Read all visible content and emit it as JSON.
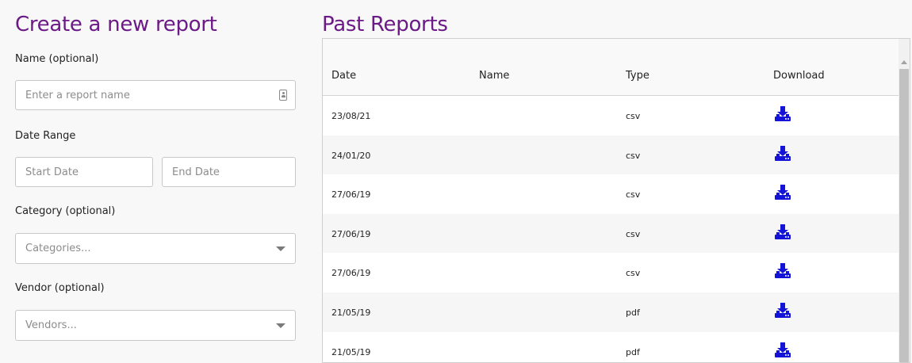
{
  "create": {
    "title": "Create a new report",
    "name_label": "Name (optional)",
    "name_placeholder": "Enter a report name",
    "date_range_label": "Date Range",
    "start_date_placeholder": "Start Date",
    "end_date_placeholder": "End Date",
    "category_label": "Category (optional)",
    "category_placeholder": "Categories...",
    "vendor_label": "Vendor (optional)",
    "vendor_placeholder": "Vendors..."
  },
  "past": {
    "title": "Past Reports",
    "columns": [
      "Date",
      "Name",
      "Type",
      "Download"
    ],
    "rows": [
      {
        "date": "23/08/21",
        "name": "",
        "type": "csv",
        "download_icon": "download-icon"
      },
      {
        "date": "24/01/20",
        "name": "",
        "type": "csv",
        "download_icon": "download-icon"
      },
      {
        "date": "27/06/19",
        "name": "",
        "type": "csv",
        "download_icon": "download-icon"
      },
      {
        "date": "27/06/19",
        "name": "",
        "type": "csv",
        "download_icon": "download-icon"
      },
      {
        "date": "27/06/19",
        "name": "",
        "type": "csv",
        "download_icon": "download-icon"
      },
      {
        "date": "21/05/19",
        "name": "",
        "type": "pdf",
        "download_icon": "download-icon"
      },
      {
        "date": "21/05/19",
        "name": "",
        "type": "pdf",
        "download_icon": "download-icon"
      }
    ]
  },
  "colors": {
    "heading": "#6b1a86",
    "download_icon": "#1414d8"
  }
}
